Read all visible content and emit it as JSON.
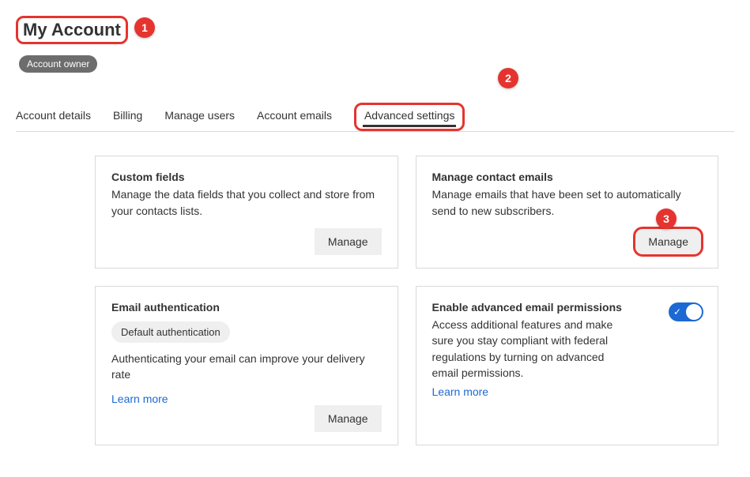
{
  "page": {
    "title": "My Account",
    "role_badge": "Account owner"
  },
  "callouts": {
    "one": "1",
    "two": "2",
    "three": "3"
  },
  "tabs": [
    {
      "label": "Account details"
    },
    {
      "label": "Billing"
    },
    {
      "label": "Manage users"
    },
    {
      "label": "Account emails"
    },
    {
      "label": "Advanced settings"
    }
  ],
  "cards": {
    "custom_fields": {
      "title": "Custom fields",
      "desc": "Manage the data fields that you collect and store from your contacts lists.",
      "button": "Manage"
    },
    "manage_contact_emails": {
      "title": "Manage contact emails",
      "desc": "Manage emails that have been set to automatically send to new subscribers.",
      "button": "Manage"
    },
    "email_auth": {
      "title": "Email authentication",
      "tag": "Default authentication",
      "desc": "Authenticating your email can improve your delivery rate",
      "learn_more": "Learn more",
      "button": "Manage"
    },
    "advanced_permissions": {
      "title": "Enable advanced email permissions",
      "desc": "Access additional features and make sure you stay compliant with federal regulations by turning on advanced email permissions.",
      "learn_more": "Learn more",
      "toggle_on": true
    }
  }
}
